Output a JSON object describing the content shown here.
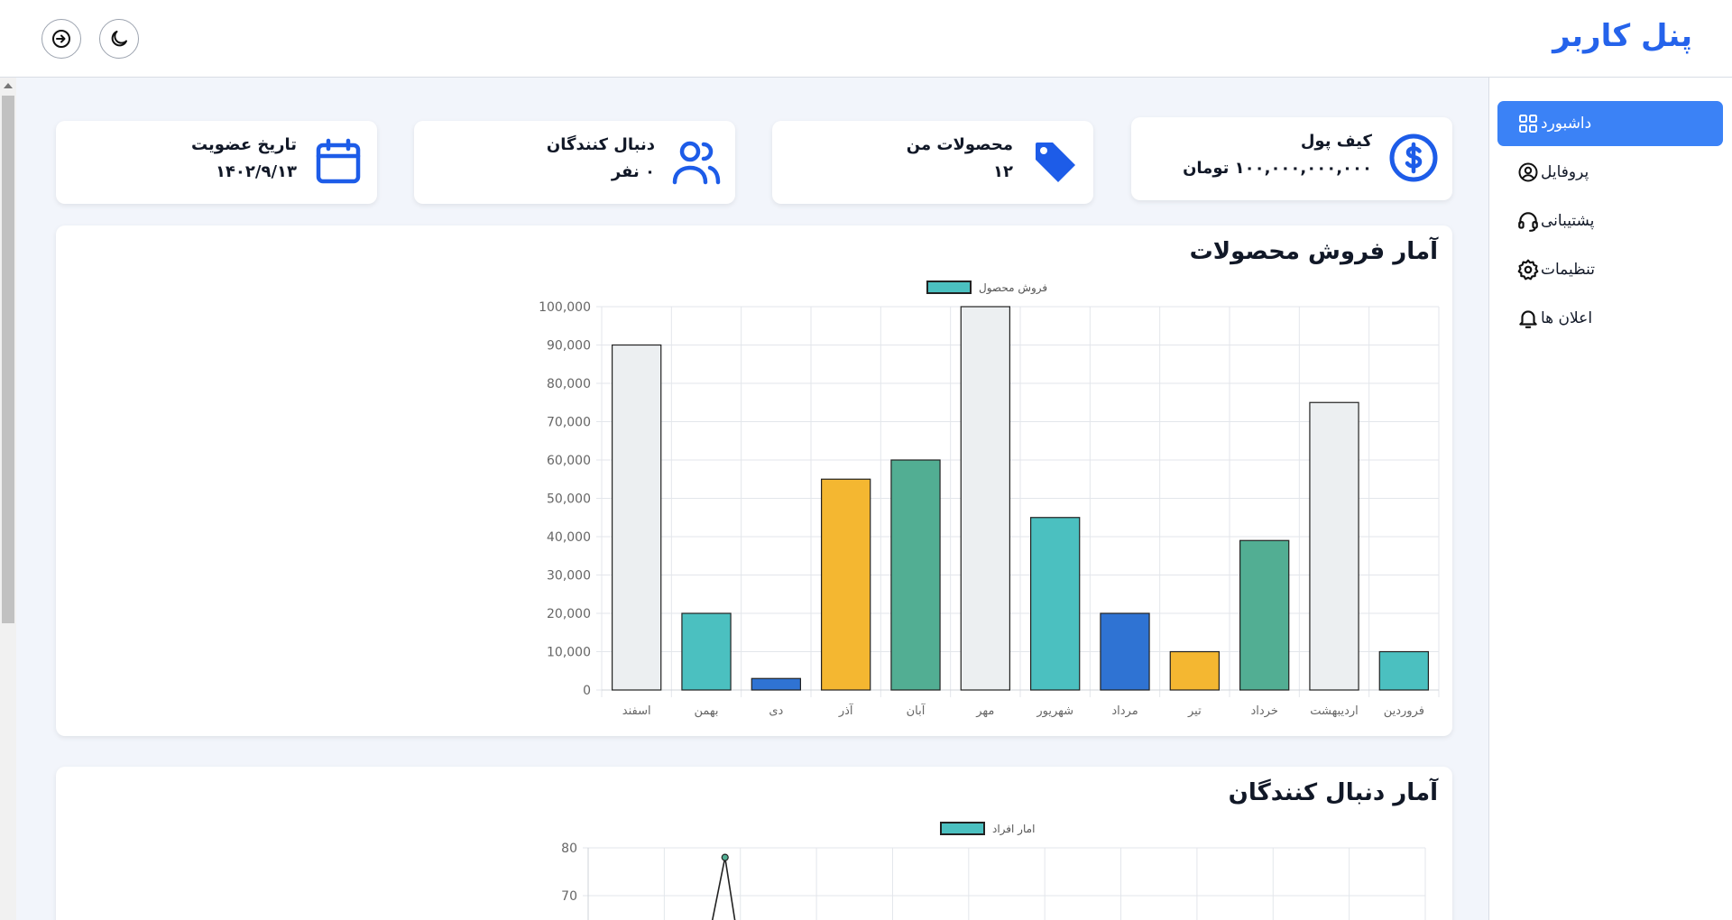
{
  "header": {
    "brand": "پنل کاربر"
  },
  "sidebar": {
    "items": [
      {
        "label": "داشبورد",
        "icon": "dashboard-grid-icon",
        "active": true
      },
      {
        "label": "پروفایل",
        "icon": "user-circle-icon",
        "active": false
      },
      {
        "label": "پشتیبانی",
        "icon": "headset-icon",
        "active": false
      },
      {
        "label": "تنظیمات",
        "icon": "gear-icon",
        "active": false
      },
      {
        "label": "اعلان ها",
        "icon": "bell-icon",
        "active": false
      }
    ]
  },
  "stats": {
    "wallet": {
      "title": "کیف پول",
      "value": "۱۰۰,۰۰۰,۰۰۰,۰۰۰ تومان",
      "icon": "dollar-icon"
    },
    "products": {
      "title": "محصولات من",
      "value": "۱۲",
      "icon": "tag-icon"
    },
    "followers": {
      "title": "دنبال کنندگان",
      "value": "۰ نفر",
      "icon": "users-icon"
    },
    "membership": {
      "title": "تاریخ عضویت",
      "value": "۱۴۰۲/۹/۱۳",
      "icon": "calendar-icon"
    }
  },
  "colors": {
    "accent": "#3b82f6",
    "brand": "#2563eb",
    "teal": "#4bc0c0",
    "green": "#52ae93",
    "yellow": "#f4b731",
    "blue": "#2f73d3",
    "light": "#eceff1"
  },
  "chart_data": [
    {
      "type": "bar",
      "title": "آمار فروش محصولات",
      "legend": "فروش محصول",
      "categories": [
        "فروردین",
        "اردیبهشت",
        "خرداد",
        "تیر",
        "مرداد",
        "شهریور",
        "مهر",
        "آبان",
        "آذر",
        "دی",
        "بهمن",
        "اسفند"
      ],
      "values": [
        10000,
        75000,
        39000,
        10000,
        20000,
        45000,
        100000,
        60000,
        55000,
        3000,
        20000,
        90000
      ],
      "bar_colors": [
        "#4bc0c0",
        "#eceff1",
        "#52ae93",
        "#f4b731",
        "#2f73d3",
        "#4bc0c0",
        "#eceff1",
        "#52ae93",
        "#f4b731",
        "#2f73d3",
        "#4bc0c0",
        "#eceff1"
      ],
      "yticks": [
        "0",
        "10,000",
        "20,000",
        "30,000",
        "40,000",
        "50,000",
        "60,000",
        "70,000",
        "80,000",
        "90,000",
        "100,000"
      ],
      "ylim": [
        0,
        100000
      ],
      "grid": true
    },
    {
      "type": "line",
      "title": "آمار دنبال کنندگان",
      "legend": "امار افراد",
      "yticks": [
        "70",
        "80"
      ],
      "visible_point": {
        "y": 78
      },
      "grid": true
    }
  ]
}
